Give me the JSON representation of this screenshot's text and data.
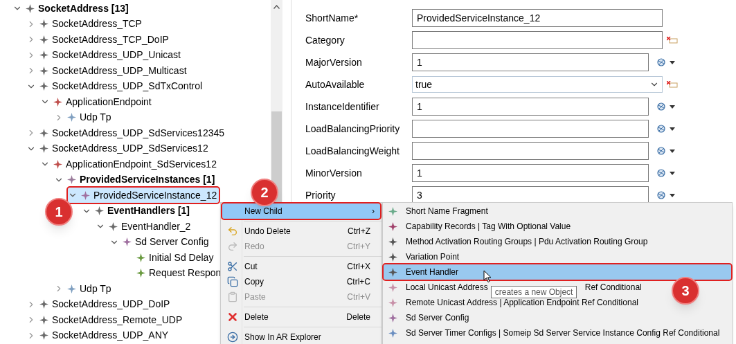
{
  "tree": [
    {
      "label": "SocketAddress [13]",
      "bold": true,
      "kind": "branch",
      "expanded": true,
      "color": "#6b6b6b",
      "selected": false,
      "children": [
        {
          "label": "SocketAddress_TCP",
          "bold": false,
          "kind": "branch",
          "expanded": false,
          "color": "#6b6b6b",
          "selected": false
        },
        {
          "label": "SocketAddress_TCP_DoIP",
          "bold": false,
          "kind": "branch",
          "expanded": false,
          "color": "#6b6b6b",
          "selected": false
        },
        {
          "label": "SocketAddress_UDP_Unicast",
          "bold": false,
          "kind": "branch",
          "expanded": false,
          "color": "#6b6b6b",
          "selected": false
        },
        {
          "label": "SocketAddress_UDP_Multicast",
          "bold": false,
          "kind": "branch",
          "expanded": false,
          "color": "#6b6b6b",
          "selected": false
        },
        {
          "label": "SocketAddress_UDP_SdTxControl",
          "bold": false,
          "kind": "branch",
          "expanded": true,
          "color": "#6b6b6b",
          "selected": false,
          "children": [
            {
              "label": "ApplicationEndpoint",
              "bold": false,
              "kind": "branch",
              "expanded": true,
              "color": "#c0504d",
              "selected": false,
              "children": [
                {
                  "label": "Udp Tp",
                  "bold": false,
                  "kind": "branch",
                  "expanded": false,
                  "color": "#7f9fc0",
                  "selected": false
                }
              ]
            }
          ]
        },
        {
          "label": "SocketAddress_UDP_SdServices12345",
          "bold": false,
          "kind": "branch",
          "expanded": false,
          "color": "#6b6b6b",
          "selected": false
        },
        {
          "label": "SocketAddress_UDP_SdServices12",
          "bold": false,
          "kind": "branch",
          "expanded": true,
          "color": "#6b6b6b",
          "selected": false,
          "children": [
            {
              "label": "ApplicationEndpoint_SdServices12",
              "bold": false,
              "kind": "branch",
              "expanded": true,
              "color": "#c0504d",
              "selected": false,
              "children": [
                {
                  "label": "ProvidedServiceInstances [1]",
                  "bold": true,
                  "kind": "branch",
                  "expanded": true,
                  "color": "#9a7a9a",
                  "selected": false,
                  "children": [
                    {
                      "label": "ProvidedServiceInstance_12",
                      "bold": false,
                      "kind": "branch",
                      "expanded": true,
                      "color": "#a070a0",
                      "selected": true,
                      "children": [
                        {
                          "label": "EventHandlers [1]",
                          "bold": true,
                          "kind": "branch",
                          "expanded": true,
                          "color": "#6b6b6b",
                          "selected": false,
                          "children": [
                            {
                              "label": "EventHandler_2",
                              "bold": false,
                              "kind": "branch",
                              "expanded": true,
                              "color": "#6b6b6b",
                              "selected": false,
                              "children": [
                                {
                                  "label": "Sd Server Config",
                                  "bold": false,
                                  "kind": "branch",
                                  "expanded": true,
                                  "color": "#a070a0",
                                  "selected": false,
                                  "children": [
                                    {
                                      "label": "Initial Sd Delay",
                                      "bold": false,
                                      "kind": "leaf",
                                      "color": "#6a9a40",
                                      "selected": false
                                    },
                                    {
                                      "label": "Request Respon",
                                      "bold": false,
                                      "kind": "leaf",
                                      "color": "#6a9a40",
                                      "selected": false
                                    }
                                  ]
                                }
                              ]
                            }
                          ]
                        }
                      ]
                    }
                  ]
                },
                {
                  "label": "Udp Tp",
                  "bold": false,
                  "kind": "branch",
                  "expanded": false,
                  "color": "#7f9fc0",
                  "selected": false
                }
              ]
            }
          ]
        },
        {
          "label": "SocketAddress_UDP_DoIP",
          "bold": false,
          "kind": "branch",
          "expanded": false,
          "color": "#6b6b6b",
          "selected": false
        },
        {
          "label": "SocketAddress_Remote_UDP",
          "bold": false,
          "kind": "branch",
          "expanded": false,
          "color": "#6b6b6b",
          "selected": false
        },
        {
          "label": "SocketAddress_UDP_ANY",
          "bold": false,
          "kind": "branch",
          "expanded": false,
          "color": "#6b6b6b",
          "selected": false
        }
      ]
    }
  ],
  "attributes": [
    {
      "label": "ShortName*",
      "value": "ProvidedServiceInstance_12",
      "kind": "text",
      "clear_button": false,
      "options_button": false
    },
    {
      "label": "Category",
      "kind": "text",
      "clear_button": true,
      "options_button": false
    },
    {
      "label": "MajorVersion",
      "value": "1",
      "kind": "text",
      "clear_button": false,
      "options_button": true
    },
    {
      "label": "AutoAvailable",
      "value": "true",
      "kind": "select",
      "clear_button": true,
      "options_button": false
    },
    {
      "label": "InstanceIdentifier",
      "value": "1",
      "kind": "text",
      "clear_button": false,
      "options_button": true
    },
    {
      "label": "LoadBalancingPriority",
      "kind": "text",
      "clear_button": false,
      "options_button": true
    },
    {
      "label": "LoadBalancingWeight",
      "kind": "text",
      "clear_button": false,
      "options_button": true
    },
    {
      "label": "MinorVersion",
      "value": "1",
      "kind": "text",
      "clear_button": false,
      "options_button": true
    },
    {
      "label": "Priority",
      "value": "3",
      "kind": "text",
      "clear_button": false,
      "options_button": true
    }
  ],
  "context_menu": {
    "groups": [
      [
        {
          "label": "New Child",
          "arrow": "›",
          "disabled": false,
          "selected": true
        }
      ],
      [
        {
          "label": "Undo Delete",
          "shortcut": "Ctrl+Z",
          "disabled": false,
          "selected": false
        },
        {
          "label": "Redo",
          "shortcut": "Ctrl+Y",
          "disabled": true,
          "selected": false
        }
      ],
      [
        {
          "label": "Cut",
          "shortcut": "Ctrl+X",
          "disabled": false,
          "selected": false
        },
        {
          "label": "Copy",
          "shortcut": "Ctrl+C",
          "disabled": false,
          "selected": false
        },
        {
          "label": "Paste",
          "shortcut": "Ctrl+V",
          "disabled": true,
          "selected": false
        }
      ],
      [
        {
          "label": "Delete",
          "shortcut": "Delete",
          "disabled": false,
          "selected": false
        }
      ],
      [
        {
          "label": "Show In AR Explorer",
          "disabled": false,
          "selected": false
        }
      ]
    ]
  },
  "submenu": {
    "items": [
      {
        "label_parts": [
          "Short Name Fragment"
        ],
        "color": "#6aab8a",
        "selected": false
      },
      {
        "label_parts": [
          "Capability Records | Tag With Optional Value"
        ],
        "color": "#a0406a",
        "selected": false
      },
      {
        "label_parts": [
          "Method Activation Routing Groups | Pdu Activation Routing Group"
        ],
        "color": "#555555",
        "selected": false
      },
      {
        "label_parts": [
          "Variation Point"
        ],
        "color": "#555555",
        "selected": false
      },
      {
        "label_parts": [
          "Event Handler"
        ],
        "color": "#555555",
        "selected": true
      },
      {
        "label_parts": [
          "Local Unicast Address",
          "Ref Conditional"
        ],
        "color": "#c890a8",
        "selected": false,
        "tooltip": "creates a new Object"
      },
      {
        "label_parts": [
          "Remote Unicast Address | Application Endpoint Ref Conditional"
        ],
        "color": "#c890a8",
        "selected": false
      },
      {
        "label_parts": [
          "Sd Server Config"
        ],
        "color": "#a070a0",
        "selected": false
      },
      {
        "label_parts": [
          "Sd Server Timer Configs | Someip Sd Server Service Instance Config Ref Conditional"
        ],
        "color": "#6a8ec0",
        "selected": false
      }
    ]
  },
  "step_badges": [
    {
      "number": "1"
    },
    {
      "number": "2"
    },
    {
      "number": "3"
    }
  ]
}
